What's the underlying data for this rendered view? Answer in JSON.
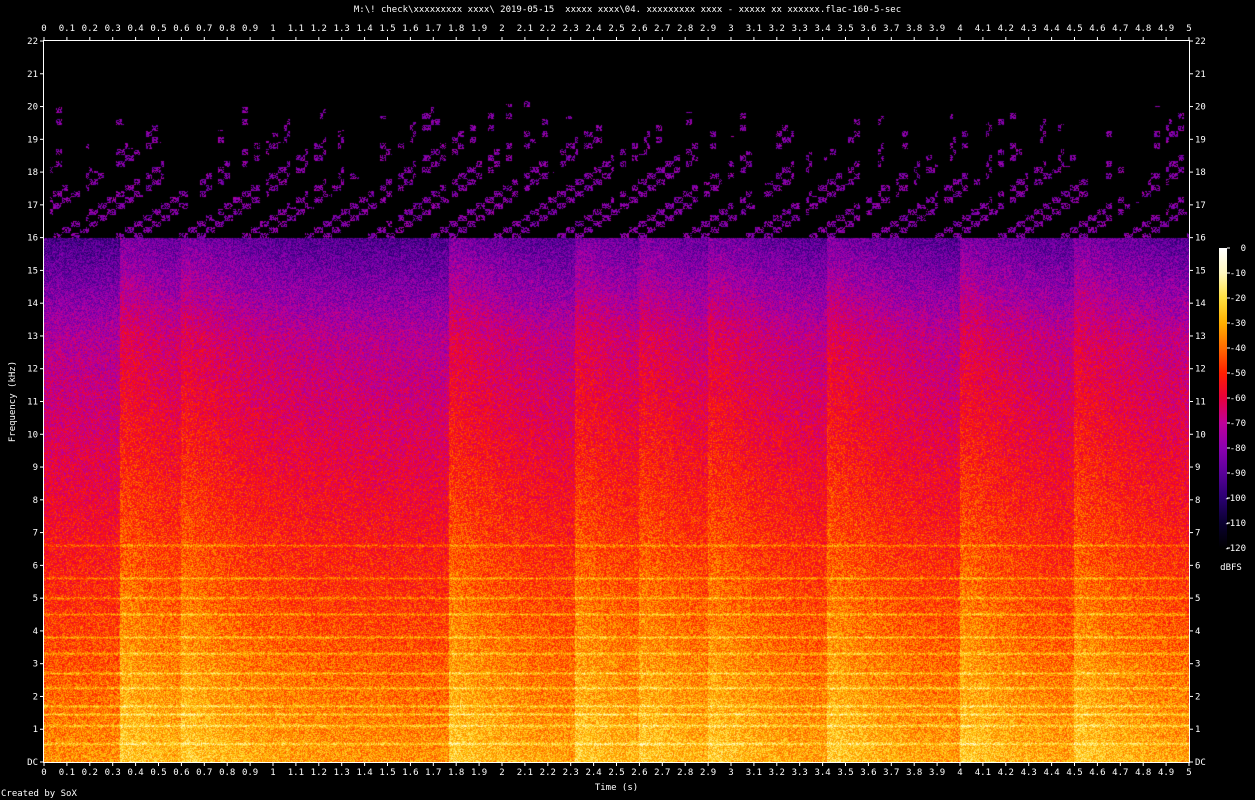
{
  "chart_data": {
    "type": "heatmap",
    "title": "M:\\! check\\xxxxxxxxx xxxx\\ 2019-05-15  xxxxx xxxx\\04. xxxxxxxxx xxxx - xxxxx xx xxxxxx.flac-160-5-sec",
    "xlabel": "Time (s)",
    "ylabel": "Frequency (kHz)",
    "colorbar_label": "dBFS",
    "credit": "Created by SoX",
    "xlim": [
      0,
      5
    ],
    "ylim": [
      0,
      22
    ],
    "x_ticks": [
      "0",
      "0.1",
      "0.2",
      "0.3",
      "0.4",
      "0.5",
      "0.6",
      "0.7",
      "0.8",
      "0.9",
      "1",
      "1.1",
      "1.2",
      "1.3",
      "1.4",
      "1.5",
      "1.6",
      "1.7",
      "1.8",
      "1.9",
      "2",
      "2.1",
      "2.2",
      "2.3",
      "2.4",
      "2.5",
      "2.6",
      "2.7",
      "2.8",
      "2.9",
      "3",
      "3.1",
      "3.2",
      "3.3",
      "3.4",
      "3.5",
      "3.6",
      "3.7",
      "3.8",
      "3.9",
      "4",
      "4.1",
      "4.2",
      "4.3",
      "4.4",
      "4.5",
      "4.6",
      "4.7",
      "4.8",
      "4.9",
      "5"
    ],
    "y_ticks": [
      "DC",
      "1",
      "2",
      "3",
      "4",
      "5",
      "6",
      "7",
      "8",
      "9",
      "10",
      "11",
      "12",
      "13",
      "14",
      "15",
      "16",
      "17",
      "18",
      "19",
      "20",
      "21",
      "22"
    ],
    "colorbar_ticks": [
      "0",
      "-10",
      "-20",
      "-30",
      "-40",
      "-50",
      "-60",
      "-70",
      "-80",
      "-90",
      "-100",
      "-110",
      "-120"
    ],
    "colorbar_range": [
      -120,
      0
    ],
    "lowpass_cutoff_khz": 16,
    "onsets_s": [
      0.33,
      0.6,
      1.77,
      2.32,
      2.6,
      2.9,
      3.42,
      4.0,
      4.5
    ],
    "colors": {
      "background": "#000000",
      "text": "#ffffff",
      "scale": [
        "#000000",
        "#0a0030",
        "#2a0070",
        "#5a009a",
        "#8c00b0",
        "#c0009a",
        "#e8003c",
        "#ff1f00",
        "#ff6a00",
        "#ffb000",
        "#ffe040",
        "#fff8c0",
        "#ffffff"
      ]
    }
  }
}
